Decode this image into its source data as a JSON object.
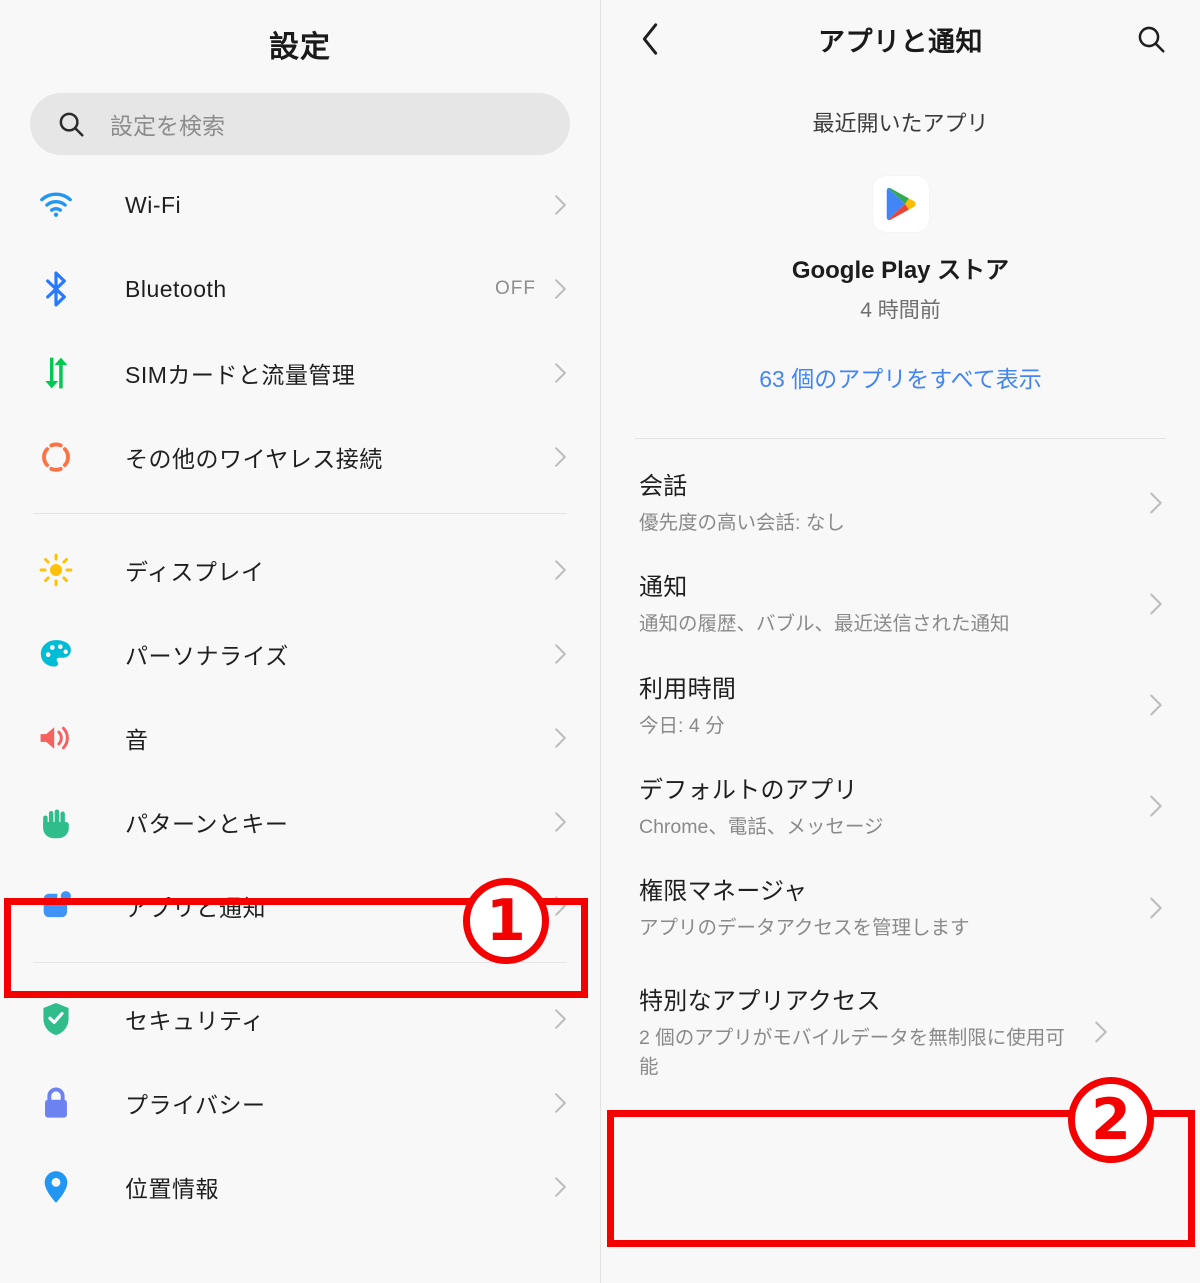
{
  "left": {
    "title": "設定",
    "search": {
      "placeholder": "設定を検索",
      "icon": "search-icon"
    },
    "items": [
      {
        "label": "Wi-Fi",
        "value": "",
        "icon": "wifi-icon"
      },
      {
        "label": "Bluetooth",
        "value": "OFF",
        "icon": "bluetooth-icon"
      },
      {
        "label": "SIMカードと流量管理",
        "value": "",
        "icon": "sim-data-icon"
      },
      {
        "label": "その他のワイヤレス接続",
        "value": "",
        "icon": "wireless-icon"
      },
      {
        "label": "ディスプレイ",
        "value": "",
        "icon": "display-brightness-icon"
      },
      {
        "label": "パーソナライズ",
        "value": "",
        "icon": "palette-icon"
      },
      {
        "label": "音",
        "value": "",
        "icon": "sound-icon"
      },
      {
        "label": "パターンとキー",
        "value": "",
        "icon": "hand-gesture-icon"
      },
      {
        "label": "アプリと通知",
        "value": "",
        "icon": "apps-notifications-icon"
      },
      {
        "label": "セキュリティ",
        "value": "",
        "icon": "shield-check-icon"
      },
      {
        "label": "プライバシー",
        "value": "",
        "icon": "lock-icon"
      },
      {
        "label": "位置情報",
        "value": "",
        "icon": "location-pin-icon"
      }
    ]
  },
  "right": {
    "back_icon": "back-chevron-icon",
    "title": "アプリと通知",
    "search_icon": "search-icon",
    "recent_label": "最近開いたアプリ",
    "app": {
      "icon": "google-play-icon",
      "name": "Google Play ストア",
      "time": "4 時間前"
    },
    "see_all": "63 個のアプリをすべて表示",
    "items": [
      {
        "title": "会話",
        "sub": "優先度の高い会話: なし"
      },
      {
        "title": "通知",
        "sub": "通知の履歴、バブル、最近送信された通知"
      },
      {
        "title": "利用時間",
        "sub": "今日: 4 分"
      },
      {
        "title": "デフォルトのアプリ",
        "sub": "Chrome、電話、メッセージ"
      },
      {
        "title": "権限マネージャ",
        "sub": "アプリのデータアクセスを管理します"
      },
      {
        "title": "特別なアプリアクセス",
        "sub": "2 個のアプリがモバイルデータを無制限に使用可能"
      }
    ]
  },
  "annotations": {
    "callout_one": "1",
    "callout_two": "2",
    "color": "#f50000"
  },
  "colors": {
    "wifi": "#2196f3",
    "bluetooth": "#2979ff",
    "sim": "#00c853",
    "wireless": "#ff7043",
    "display": "#ffc107",
    "palette": "#00bcd4",
    "sound": "#f4615e",
    "hand": "#2ebd8b",
    "apps": "#4094f7",
    "shield": "#2ebd8b",
    "lock": "#6b82f0",
    "location": "#2196f3",
    "link": "#4285f4"
  }
}
